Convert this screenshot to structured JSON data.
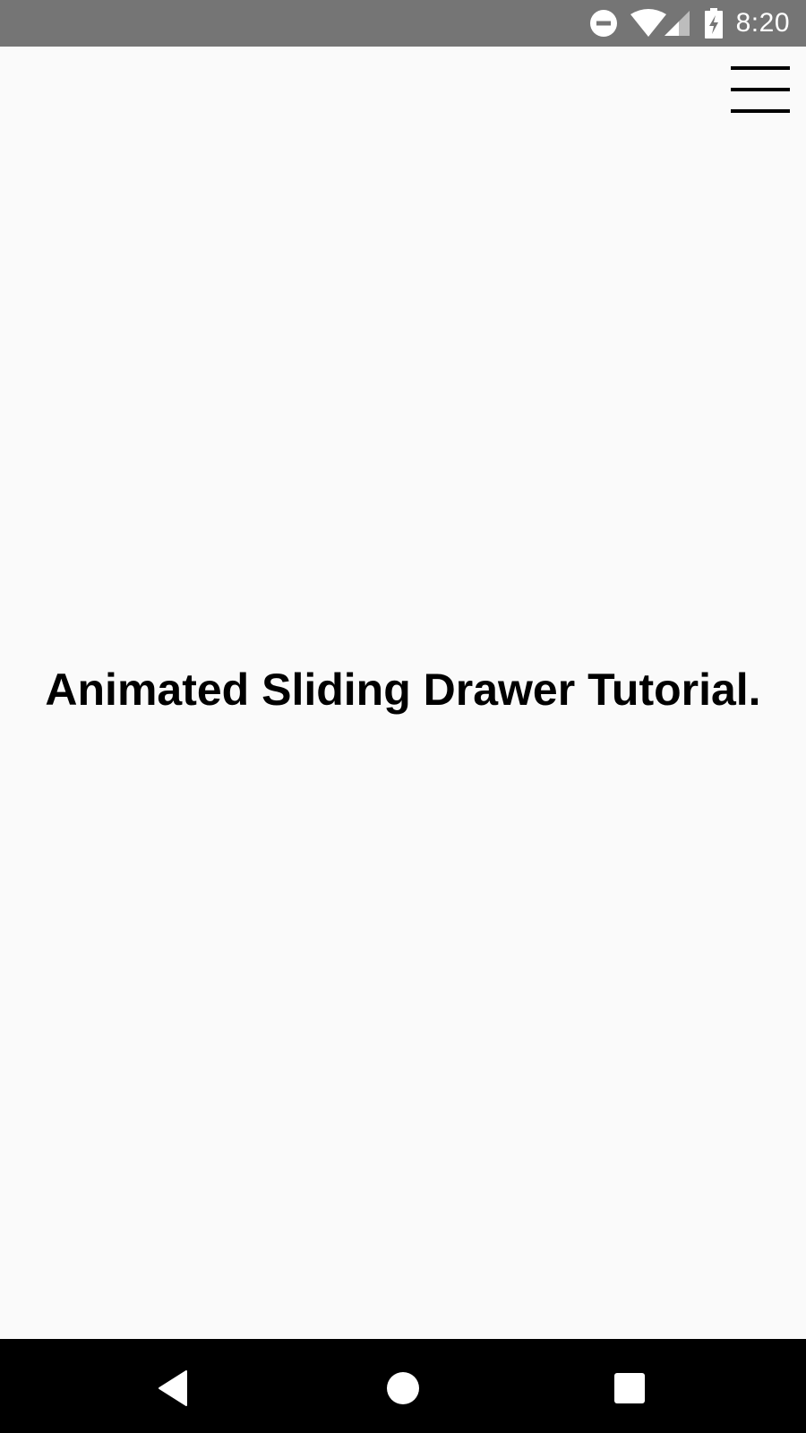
{
  "status_bar": {
    "time": "8:20",
    "icons": [
      "do-not-disturb-icon",
      "wifi-icon",
      "cellular-signal-icon",
      "battery-charging-icon"
    ]
  },
  "toolbar": {
    "menu_icon": "hamburger-menu-icon"
  },
  "main": {
    "title": "Animated Sliding Drawer Tutorial."
  },
  "nav_bar": {
    "buttons": [
      "back-icon",
      "home-icon",
      "recents-icon"
    ]
  },
  "colors": {
    "status_bar_bg": "#757575",
    "background": "#fafafa",
    "nav_bar_bg": "#000000",
    "text": "#000000"
  }
}
